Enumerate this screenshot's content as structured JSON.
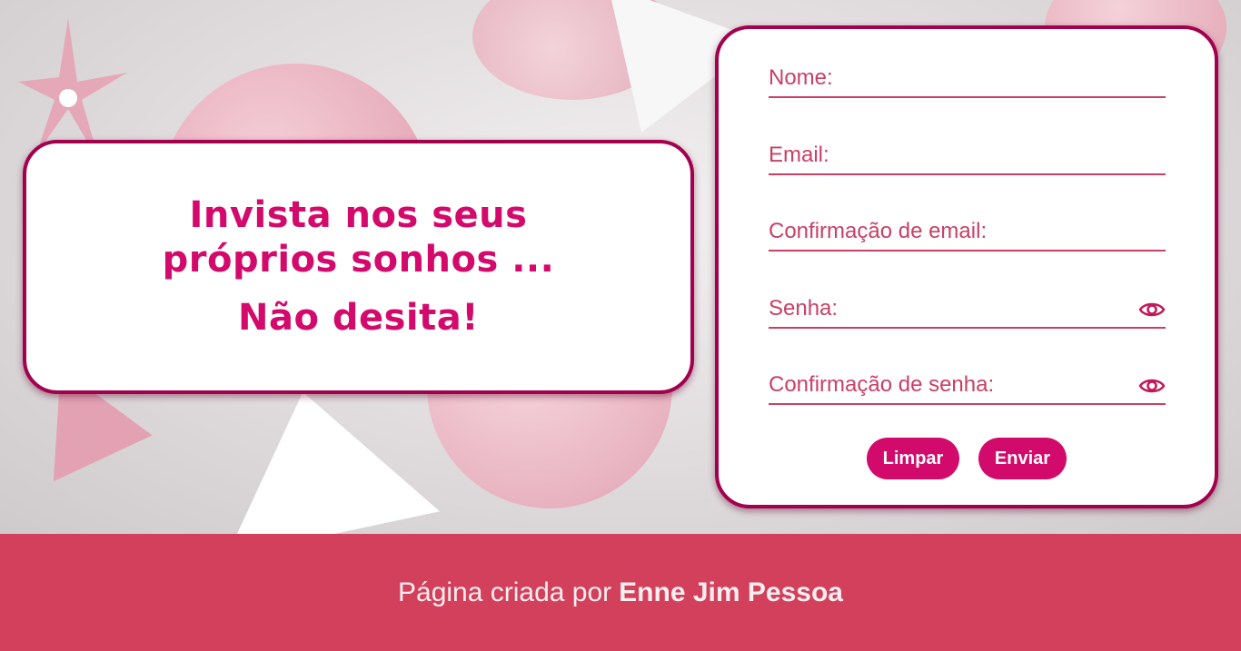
{
  "hero": {
    "headline": "Invista nos seus próprios sonhos ...",
    "subheadline": "Não desita!"
  },
  "form": {
    "fields": [
      {
        "placeholder": "Nome:",
        "type": "text",
        "has_eye": false
      },
      {
        "placeholder": "Email:",
        "type": "email",
        "has_eye": false
      },
      {
        "placeholder": "Confirmação de email:",
        "type": "email",
        "has_eye": false
      },
      {
        "placeholder": "Senha:",
        "type": "password",
        "has_eye": true
      },
      {
        "placeholder": "Confirmação de senha:",
        "type": "password",
        "has_eye": true
      }
    ],
    "eye_icon": "eye-icon",
    "clear_label": "Limpar",
    "submit_label": "Enviar"
  },
  "footer": {
    "prefix": "Página criada por",
    "author": "Enne Jim Pessoa"
  },
  "colors": {
    "accent": "#d10a6b",
    "border": "#a3004e",
    "field_text": "#c94066",
    "footer_bg": "#d2405c"
  }
}
